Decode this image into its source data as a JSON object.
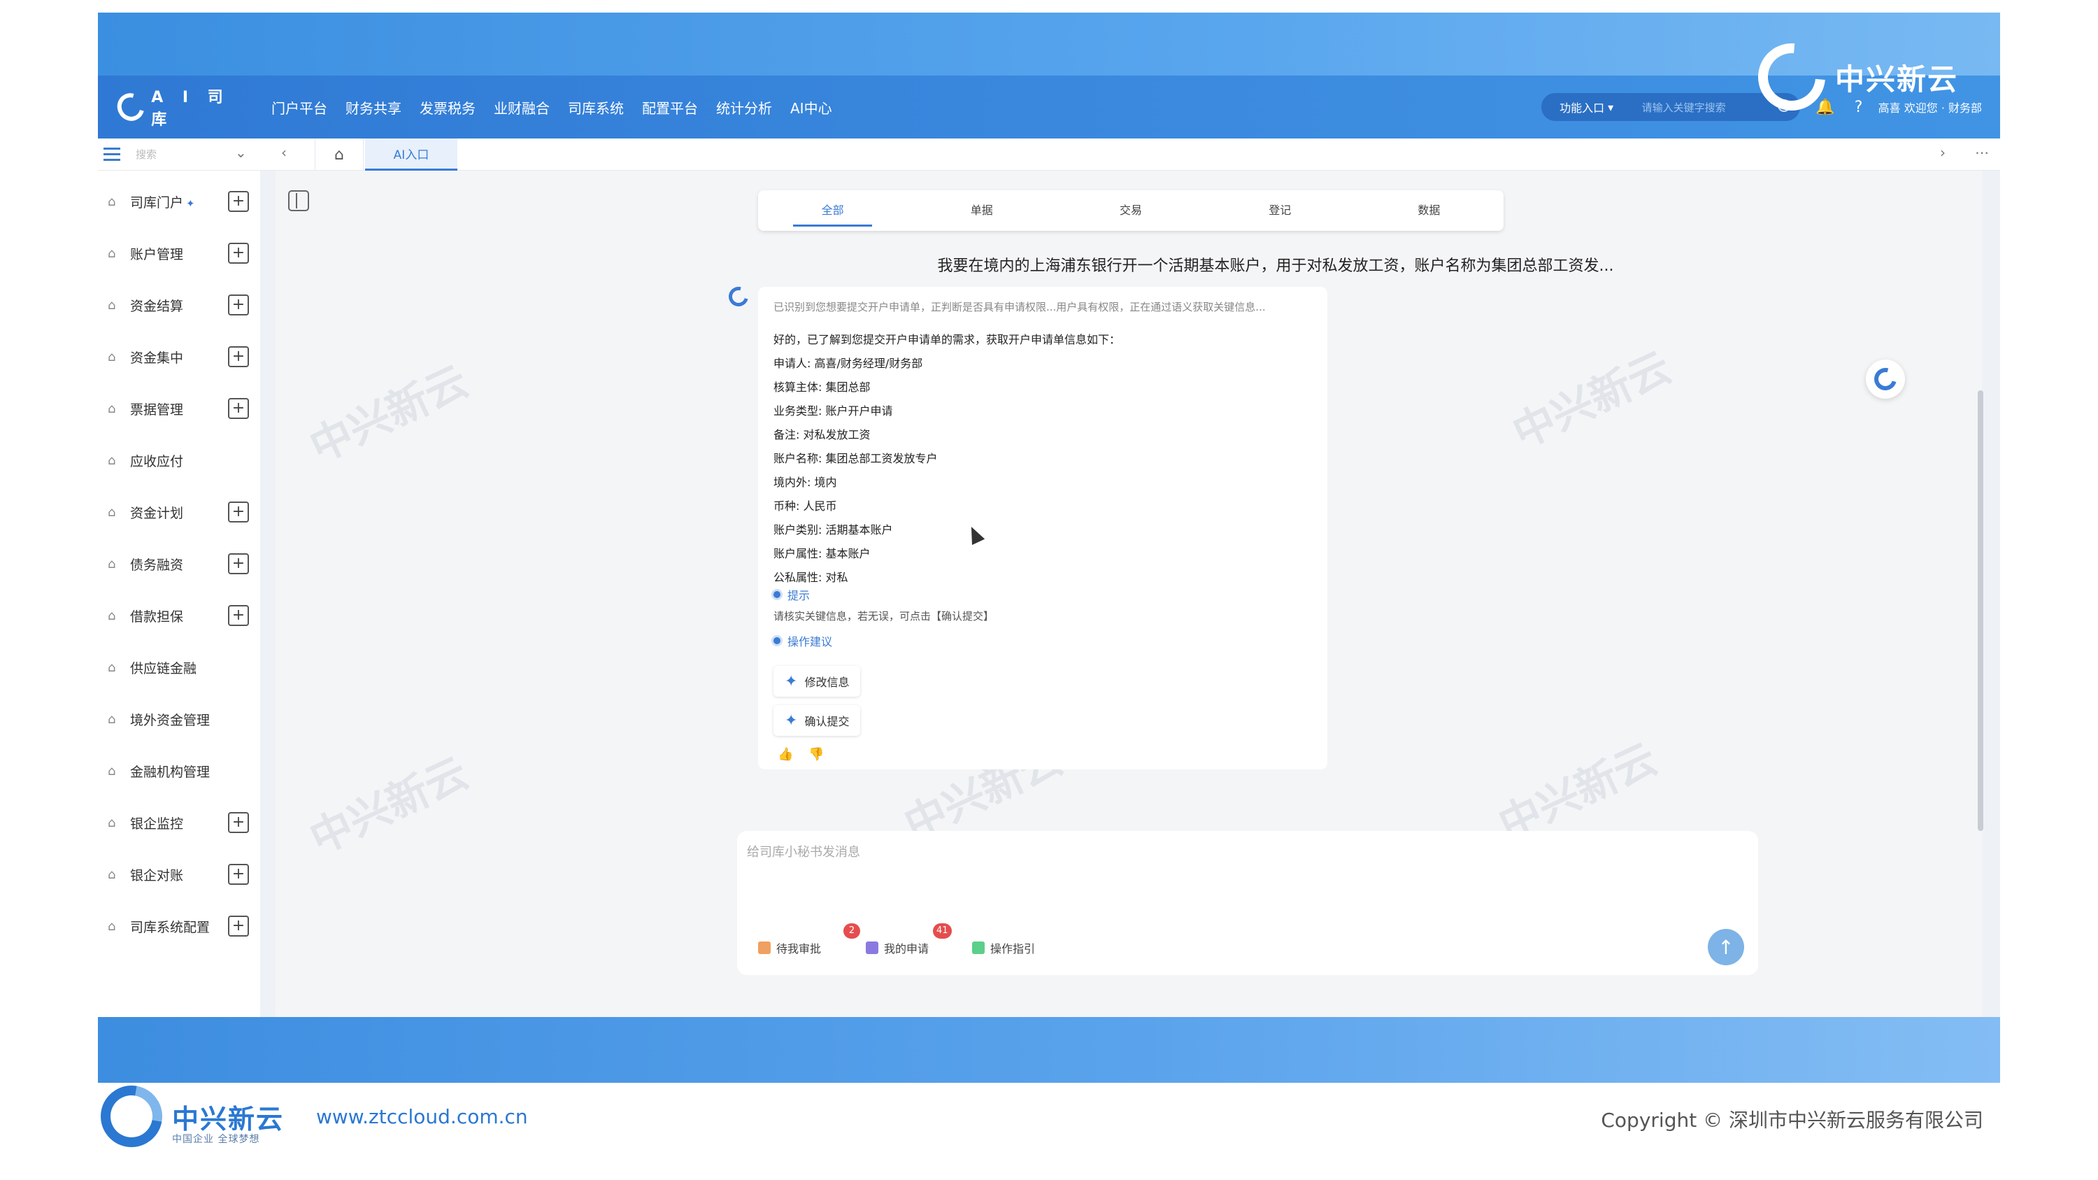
{
  "app": {
    "logo_text": "A I 司 库",
    "menu": [
      "门户平台",
      "财务共享",
      "发票税务",
      "业财融合",
      "司库系统",
      "配置平台",
      "统计分析",
      "AI中心"
    ],
    "function_entry": "功能入口",
    "search_placeholder": "请输入关键字搜索",
    "user_text": "高喜 欢迎您 · 财务部",
    "brand_name": "中兴新云"
  },
  "tabbar": {
    "side_search_placeholder": "搜索",
    "active_tab": "AI入口"
  },
  "sidebar": {
    "items": [
      {
        "label": "司库门户",
        "has_plus": true,
        "sparkle": true
      },
      {
        "label": "账户管理",
        "has_plus": true
      },
      {
        "label": "资金结算",
        "has_plus": true
      },
      {
        "label": "资金集中",
        "has_plus": true
      },
      {
        "label": "票据管理",
        "has_plus": true
      },
      {
        "label": "应收应付",
        "has_plus": false
      },
      {
        "label": "资金计划",
        "has_plus": true
      },
      {
        "label": "债务融资",
        "has_plus": true
      },
      {
        "label": "借款担保",
        "has_plus": true
      },
      {
        "label": "供应链金融",
        "has_plus": false
      },
      {
        "label": "境外资金管理",
        "has_plus": false
      },
      {
        "label": "金融机构管理",
        "has_plus": false
      },
      {
        "label": "银企监控",
        "has_plus": true
      },
      {
        "label": "银企对账",
        "has_plus": true
      },
      {
        "label": "司库系统配置",
        "has_plus": true
      }
    ]
  },
  "filter_tabs": [
    "全部",
    "单据",
    "交易",
    "登记",
    "数据"
  ],
  "chat": {
    "user_message": "我要在境内的上海浦东银行开一个活期基本账户，用于对私发放工资，账户名称为集团总部工资发...",
    "thinking": "已识别到您想要提交开户申请单，正判断是否具有申请权限...用户具有权限，正在通过语义获取关键信息...",
    "intro": "好的，已了解到您提交开户申请单的需求，获取开户申请单信息如下：",
    "fields": [
      "申请人: 高喜/财务经理/财务部",
      "核算主体: 集团总部",
      "业务类型: 账户开户申请",
      "备注: 对私发放工资",
      "账户名称: 集团总部工资发放专户",
      "境内外: 境内",
      "币种: 人民币",
      "账户类别: 活期基本账户",
      "账户属性: 基本账户",
      "公私属性: 对私"
    ],
    "hint_title": "提示",
    "hint_text": "请核实关键信息，若无误，可点击【确认提交】",
    "suggest_title": "操作建议",
    "actions": [
      "修改信息",
      "确认提交"
    ]
  },
  "composer": {
    "placeholder": "给司库小秘书发消息",
    "chips": [
      {
        "label": "待我审批",
        "count": "2",
        "color": "#f0a060"
      },
      {
        "label": "我的申请",
        "count": "41",
        "color": "#8a7ae0"
      },
      {
        "label": "操作指引",
        "count": "",
        "color": "#5ccf8a"
      }
    ]
  },
  "watermark": "中兴新云",
  "footer": {
    "brand": "中兴新云",
    "slogan": "中国企业 全球梦想",
    "url": "www.ztccloud.com.cn",
    "copyright": "Copyright © 深圳市中兴新云服务有限公司"
  }
}
